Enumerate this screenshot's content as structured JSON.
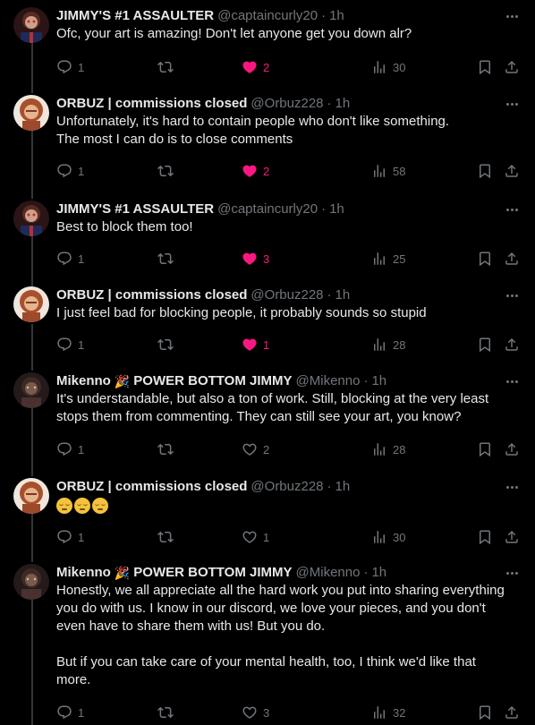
{
  "colors": {
    "like_active": "#f91880",
    "muted": "#71767b",
    "text": "#e7e9ea",
    "background": "#000000"
  },
  "tweets": [
    {
      "name": "JIMMY'S #1 ASSAULTER",
      "handle": "@captaincurly20",
      "dot": "·",
      "time": "1h",
      "text": "Ofc, your art is amazing! Don't let anyone get you down alr?",
      "replies": "1",
      "retweets": "",
      "likes": "2",
      "liked": true,
      "views": "30"
    },
    {
      "name": "ORBUZ | commissions closed",
      "handle": "@Orbuz228",
      "dot": "·",
      "time": "1h",
      "text": "Unfortunately, it's hard to contain people who don't like something.\nThe most I can do is to close comments",
      "replies": "1",
      "retweets": "",
      "likes": "2",
      "liked": true,
      "views": "58"
    },
    {
      "name": "JIMMY'S #1 ASSAULTER",
      "handle": "@captaincurly20",
      "dot": "·",
      "time": "1h",
      "text": "Best to block them too!",
      "replies": "1",
      "retweets": "",
      "likes": "3",
      "liked": true,
      "views": "25"
    },
    {
      "name": "ORBUZ | commissions closed",
      "handle": "@Orbuz228",
      "dot": "·",
      "time": "1h",
      "text": "I just feel bad for blocking people, it probably sounds so stupid",
      "replies": "1",
      "retweets": "",
      "likes": "1",
      "liked": true,
      "views": "28"
    },
    {
      "name": "Mikenno",
      "name_suffix": "POWER BOTTOM JIMMY",
      "handle": "@Mikenno",
      "dot": "·",
      "time": "1h",
      "text": "It's understandable, but also a ton of work. Still, blocking at the very least\nstops them from commenting. They can still see your art, you know?",
      "replies": "1",
      "retweets": "",
      "likes": "2",
      "liked": false,
      "views": "28"
    },
    {
      "name": "ORBUZ | commissions closed",
      "handle": "@Orbuz228",
      "dot": "·",
      "time": "1h",
      "text": "",
      "emoji_count": 3,
      "replies": "1",
      "retweets": "",
      "likes": "1",
      "liked": false,
      "views": "30"
    },
    {
      "name": "Mikenno",
      "name_suffix": "POWER BOTTOM JIMMY",
      "handle": "@Mikenno",
      "dot": "·",
      "time": "1h",
      "text": "Honestly, we all appreciate all the hard work you put into sharing everything\nyou do with us. I know in our discord, we love your pieces, and you don't\neven have to share them with us! But you do.\n\nBut if you can take care of your mental health, too, I think we'd like that\nmore.",
      "replies": "1",
      "retweets": "",
      "likes": "3",
      "liked": false,
      "views": "32"
    }
  ]
}
